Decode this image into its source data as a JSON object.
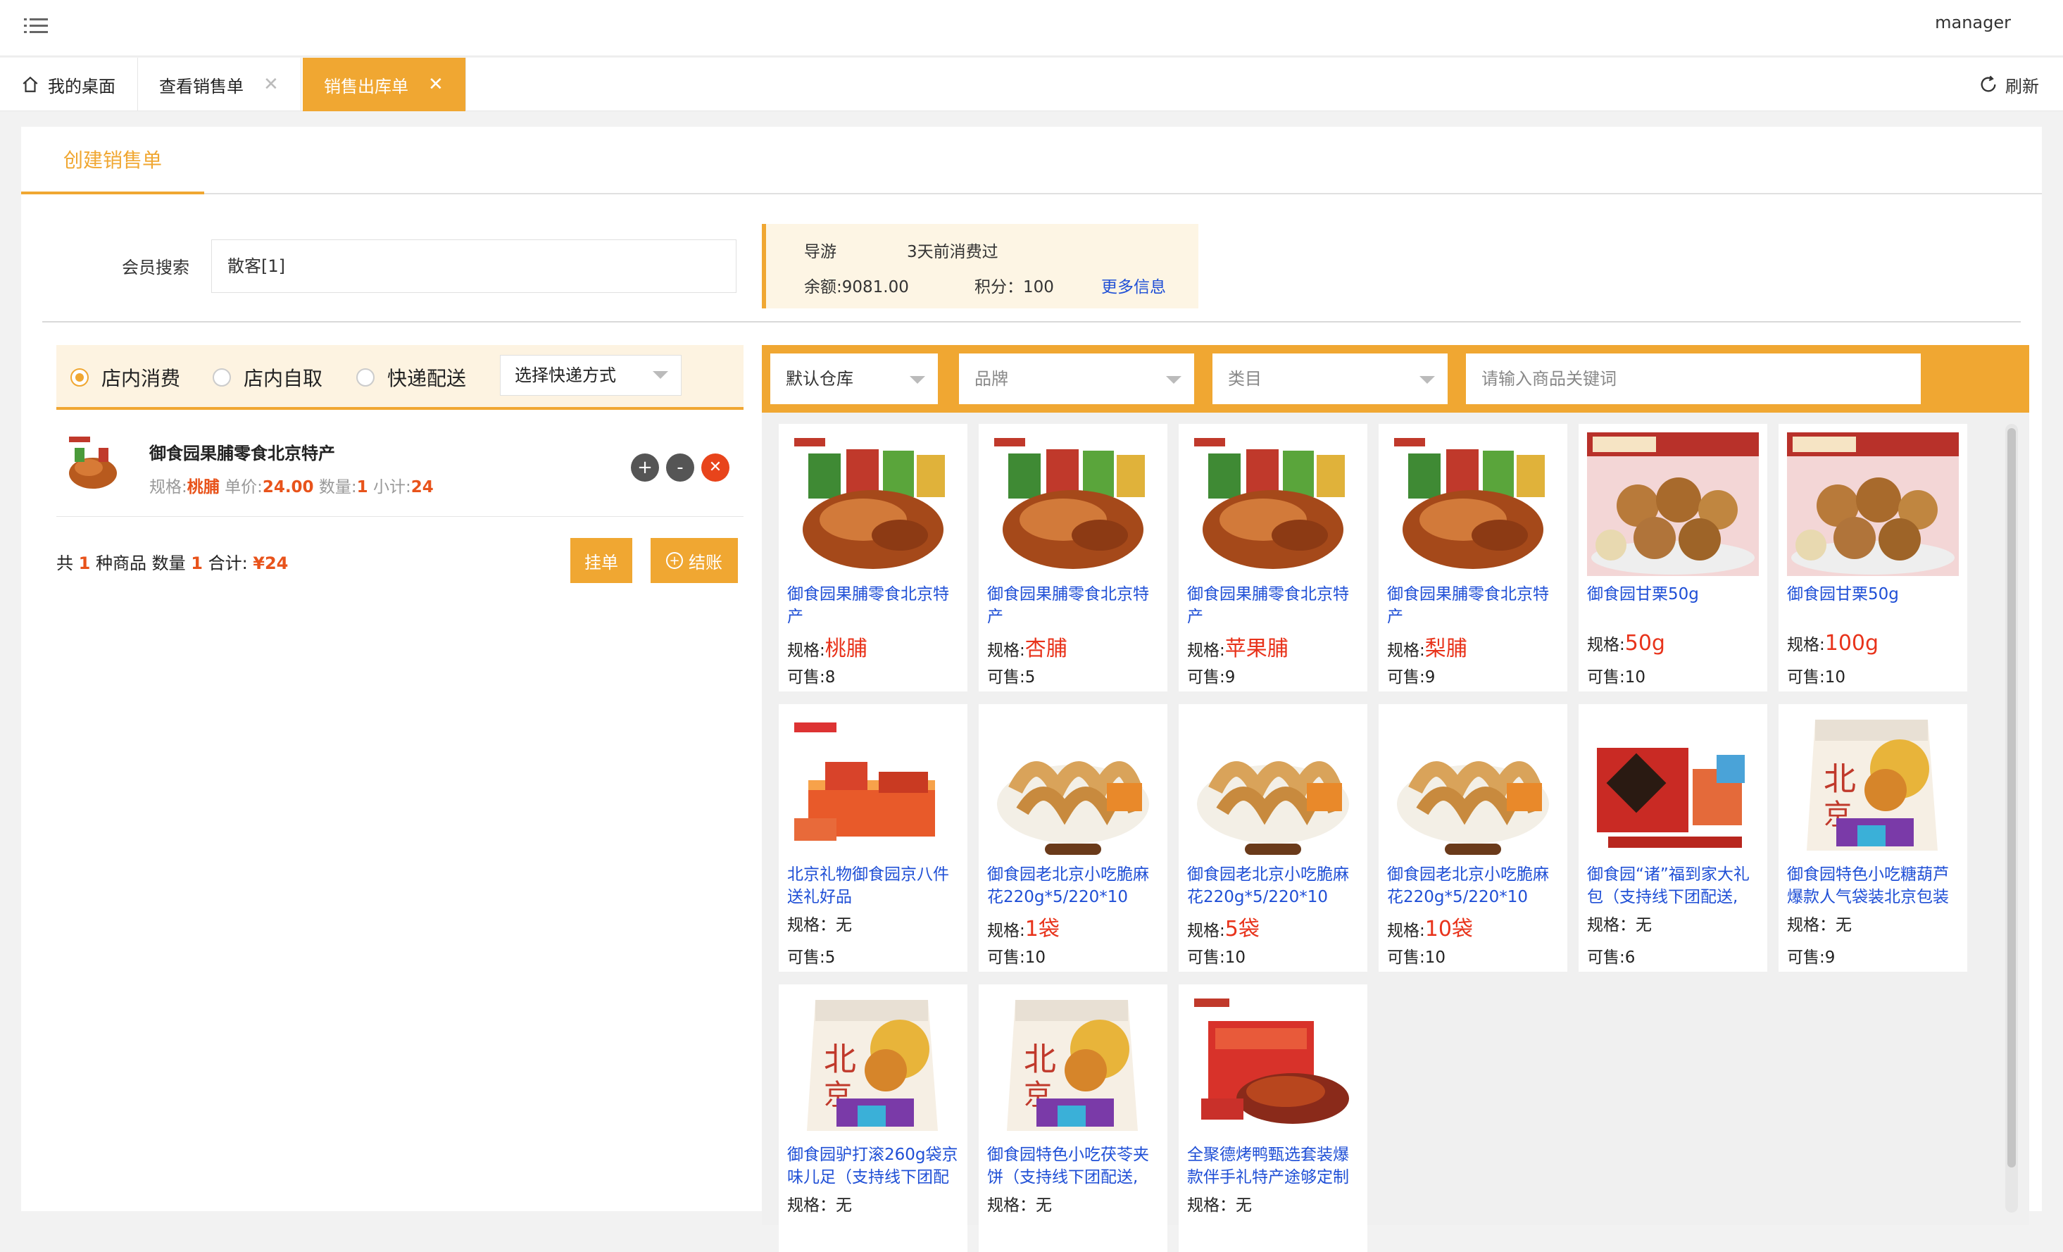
{
  "topbar": {
    "user": "manager"
  },
  "tabs": [
    {
      "label": "我的桌面"
    },
    {
      "label": "查看销售单"
    },
    {
      "label": "销售出库单"
    }
  ],
  "refresh_label": "刷新",
  "subtab_label": "创建销售单",
  "member": {
    "label": "会员搜索",
    "value": "散客[1]",
    "guide": "导游",
    "last_visit": "3天前消费过",
    "balance": "余额:9081.00",
    "points": "积分：100",
    "more": "更多信息"
  },
  "delivery": {
    "options": [
      "店内消费",
      "店内自取",
      "快递配送"
    ],
    "selected": 0,
    "express_placeholder": "选择快递方式"
  },
  "cart": {
    "items": [
      {
        "name": "御食园果脯零食北京特产",
        "spec_label": "规格:",
        "spec": "桃脯",
        "price_label": "单价:",
        "price": "24.00",
        "qty_label": "数量:",
        "qty": "1",
        "subtotal_label": "小计:",
        "subtotal": "24"
      }
    ],
    "summary": {
      "p1": "共 ",
      "kinds": "1",
      "p2": " 种商品 数量 ",
      "qty": "1",
      "p3": " 合计: ",
      "total": "¥24"
    },
    "hold_label": "挂单",
    "pay_label": "结账"
  },
  "filters": {
    "warehouse": "默认仓库",
    "brand": "品牌",
    "category": "类目",
    "keyword_placeholder": "请输入商品关键词"
  },
  "products": [
    {
      "name": "御食园果脯零食北京特产",
      "spec": "桃脯",
      "stock": "可售:8",
      "img": "jar"
    },
    {
      "name": "御食园果脯零食北京特产",
      "spec": "杏脯",
      "stock": "可售:5",
      "img": "jar"
    },
    {
      "name": "御食园果脯零食北京特产",
      "spec": "苹果脯",
      "stock": "可售:9",
      "img": "jar"
    },
    {
      "name": "御食园果脯零食北京特产",
      "spec": "梨脯",
      "stock": "可售:9",
      "img": "jar"
    },
    {
      "name": "御食园甘栗50g",
      "spec": "50g",
      "stock": "可售:10",
      "img": "chestnut"
    },
    {
      "name": "御食园甘栗50g",
      "spec": "100g",
      "stock": "可售:10",
      "img": "chestnut"
    },
    {
      "name": "北京礼物御食园京八件送礼好品",
      "spec": "无",
      "stock": "可售:5",
      "img": "giftbox"
    },
    {
      "name": "御食园老北京小吃脆麻花220g*5/220*10",
      "spec": "1袋",
      "stock": "可售:10",
      "img": "twist"
    },
    {
      "name": "御食园老北京小吃脆麻花220g*5/220*10",
      "spec": "5袋",
      "stock": "可售:10",
      "img": "twist"
    },
    {
      "name": "御食园老北京小吃脆麻花220g*5/220*10",
      "spec": "10袋",
      "stock": "可售:10",
      "img": "twist"
    },
    {
      "name": "御食园“诸”福到家大礼包（支持线下团配送,",
      "spec": "无",
      "stock": "可售:6",
      "img": "bigpack"
    },
    {
      "name": "御食园特色小吃糖葫芦爆款人气袋装北京包装",
      "spec": "无",
      "stock": "可售:9",
      "img": "bag"
    },
    {
      "name": "御食园驴打滚260g袋京味儿足（支持线下团配",
      "spec": "无",
      "stock": "",
      "img": "bag"
    },
    {
      "name": "御食园特色小吃茯苓夹饼（支持线下团配送,",
      "spec": "无",
      "stock": "",
      "img": "bag"
    },
    {
      "name": "全聚德烤鸭甄选套装爆款伴手礼特产途够定制",
      "spec": "无",
      "stock": "",
      "img": "duck"
    }
  ],
  "spec_label": "规格:",
  "spec_label_plain": "规格：",
  "colors": {
    "accent": "#f0a732",
    "link": "#1f4fd6",
    "price": "#e8331b"
  }
}
